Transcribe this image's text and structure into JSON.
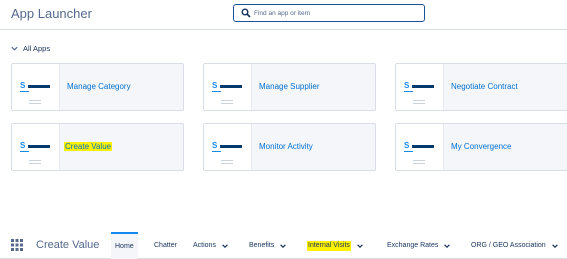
{
  "header": {
    "title": "App Launcher",
    "search_placeholder": "Find an app or item"
  },
  "section": {
    "label": "All Apps"
  },
  "tiles": [
    {
      "name": "Manage Category",
      "highlighted": false
    },
    {
      "name": "Manage Supplier",
      "highlighted": false
    },
    {
      "name": "Negotiate Contract",
      "highlighted": false
    },
    {
      "name": "Create Value",
      "highlighted": true
    },
    {
      "name": "Monitor Activity",
      "highlighted": false
    },
    {
      "name": "My Convergence",
      "highlighted": false
    }
  ],
  "nav": {
    "app_name": "Create Value",
    "items": [
      {
        "label": "Home",
        "active": true,
        "dropdown": false
      },
      {
        "label": "Chatter",
        "active": false,
        "dropdown": false
      },
      {
        "label": "Actions",
        "active": false,
        "dropdown": true
      },
      {
        "label": "Benefits",
        "active": false,
        "dropdown": true
      },
      {
        "label": "Internal Visits",
        "active": false,
        "dropdown": true,
        "highlighted": true
      },
      {
        "label": "Exchange Rates",
        "active": false,
        "dropdown": true
      },
      {
        "label": "ORG / GEO Association",
        "active": false,
        "dropdown": true
      }
    ]
  },
  "colors": {
    "accent": "#1589ee",
    "link": "#0070d2",
    "highlight": "#fff200"
  }
}
